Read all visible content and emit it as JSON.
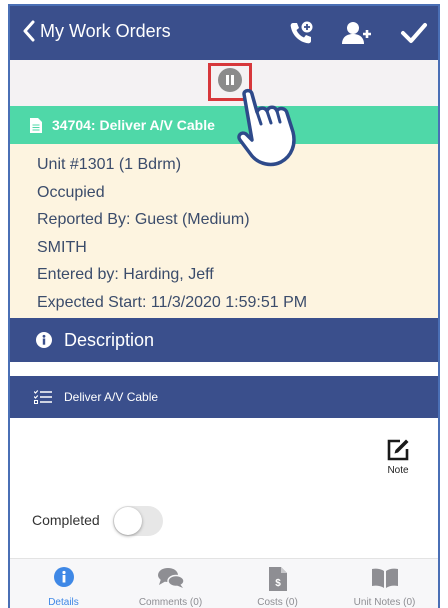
{
  "header": {
    "back_label": "My Work Orders"
  },
  "work_order": {
    "title": "34704: Deliver A/V Cable",
    "unit": "Unit #1301 (1 Bdrm)",
    "occupancy": "Occupied",
    "reported_by": "Reported By: Guest  (Medium)",
    "reporter_name": "SMITH",
    "entered_by": "Entered by: Harding, Jeff",
    "expected_start": "Expected Start: 11/3/2020 1:59:51 PM"
  },
  "description": {
    "header": "Description"
  },
  "task": {
    "label": "Deliver A/V Cable",
    "note_label": "Note",
    "completed_label": "Completed",
    "completed": false
  },
  "tabs": [
    {
      "label": "Details",
      "icon": "info-icon",
      "active": true
    },
    {
      "label": "Comments (0)",
      "icon": "comments-icon",
      "active": false
    },
    {
      "label": "Costs (0)",
      "icon": "costs-icon",
      "active": false
    },
    {
      "label": "Unit Notes (0)",
      "icon": "book-icon",
      "active": false
    }
  ],
  "colors": {
    "header": "#3a4f8c",
    "title_bar": "#4fd8a8",
    "info_bg": "#fdf4e0",
    "highlight": "#d7383b",
    "active_tab": "#3f88e6"
  }
}
